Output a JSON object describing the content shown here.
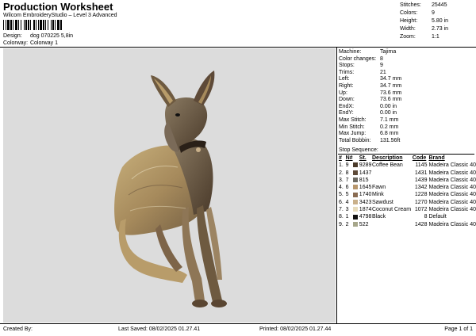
{
  "header": {
    "title": "Production Worksheet",
    "subtitle": "Wilcom EmbroideryStudio – Level 3 Advanced",
    "design_label": "Design:",
    "design_value": "dog 070225 5,8in",
    "colorway_label": "Colorway:",
    "colorway_value": "Colorway 1"
  },
  "top_stats": [
    {
      "label": "Stitches:",
      "value": "25445"
    },
    {
      "label": "Colors:",
      "value": "9"
    },
    {
      "label": "Height:",
      "value": "5.80 in"
    },
    {
      "label": "Width:",
      "value": "2.73 in"
    },
    {
      "label": "Zoom:",
      "value": "1:1"
    }
  ],
  "info": [
    {
      "label": "Machine:",
      "value": "Tajima"
    },
    {
      "label": "Color changes:",
      "value": "8"
    },
    {
      "label": "Stops:",
      "value": "9"
    },
    {
      "label": "Trims:",
      "value": "21"
    },
    {
      "label": "Left:",
      "value": "34.7 mm"
    },
    {
      "label": "Right:",
      "value": "34.7 mm"
    },
    {
      "label": "Up:",
      "value": "73.6 mm"
    },
    {
      "label": "Down:",
      "value": "73.6 mm"
    },
    {
      "label": "EndX:",
      "value": "0.00 in"
    },
    {
      "label": "EndY:",
      "value": "0.00 in"
    },
    {
      "label": "Max Stitch:",
      "value": "7.1 mm"
    },
    {
      "label": "Min Stitch:",
      "value": "0.2 mm"
    },
    {
      "label": "Max Jump:",
      "value": "6.8 mm"
    },
    {
      "label": "Total Bobbin:",
      "value": "131.56ft"
    }
  ],
  "stop_sequence": {
    "title": "Stop Sequence:",
    "headers": {
      "num": "#",
      "n": "N#",
      "st": "St.",
      "desc": "Description",
      "code": "Code",
      "brand": "Brand"
    },
    "rows": [
      {
        "num": "1.",
        "n": "9",
        "color": "#4a3a2a",
        "st": "9289",
        "desc": "Coffee Bean",
        "code": "1145",
        "brand": "Madeira Classic 40"
      },
      {
        "num": "2.",
        "n": "8",
        "color": "#5e4a38",
        "st": "1437",
        "desc": "",
        "code": "1431",
        "brand": "Madeira Classic 40"
      },
      {
        "num": "3.",
        "n": "7",
        "color": "#6d6a62",
        "st": "815",
        "desc": "",
        "code": "1439",
        "brand": "Madeira Classic 40"
      },
      {
        "num": "4.",
        "n": "6",
        "color": "#b7966c",
        "st": "1645",
        "desc": "Fawn",
        "code": "1342",
        "brand": "Madeira Classic 40"
      },
      {
        "num": "5.",
        "n": "5",
        "color": "#8a6c52",
        "st": "1740",
        "desc": "Mink",
        "code": "1228",
        "brand": "Madeira Classic 40"
      },
      {
        "num": "6.",
        "n": "4",
        "color": "#c9b08a",
        "st": "3423",
        "desc": "Sawdust",
        "code": "1270",
        "brand": "Madeira Classic 40"
      },
      {
        "num": "7.",
        "n": "3",
        "color": "#e8dcbc",
        "st": "1874",
        "desc": "Coconut Cream",
        "code": "1072",
        "brand": "Madeira Classic 40"
      },
      {
        "num": "8.",
        "n": "1",
        "color": "#111111",
        "st": "4798",
        "desc": "Black",
        "code": "8",
        "brand": "Default"
      },
      {
        "num": "9.",
        "n": "2",
        "color": "#a6a68a",
        "st": "522",
        "desc": "",
        "code": "1428",
        "brand": "Madeira Classic 40"
      }
    ]
  },
  "footer": {
    "created_by": "Created By:",
    "last_saved": "Last Saved: 08/02/2025 01.27.41",
    "printed": "Printed: 08/02/2025 01.27.44",
    "page": "Page 1 of 1"
  },
  "colors": {
    "preview_bg": "#dcdcdc",
    "dog_light": "#b89c6a",
    "dog_dark": "#4a3a2a"
  }
}
